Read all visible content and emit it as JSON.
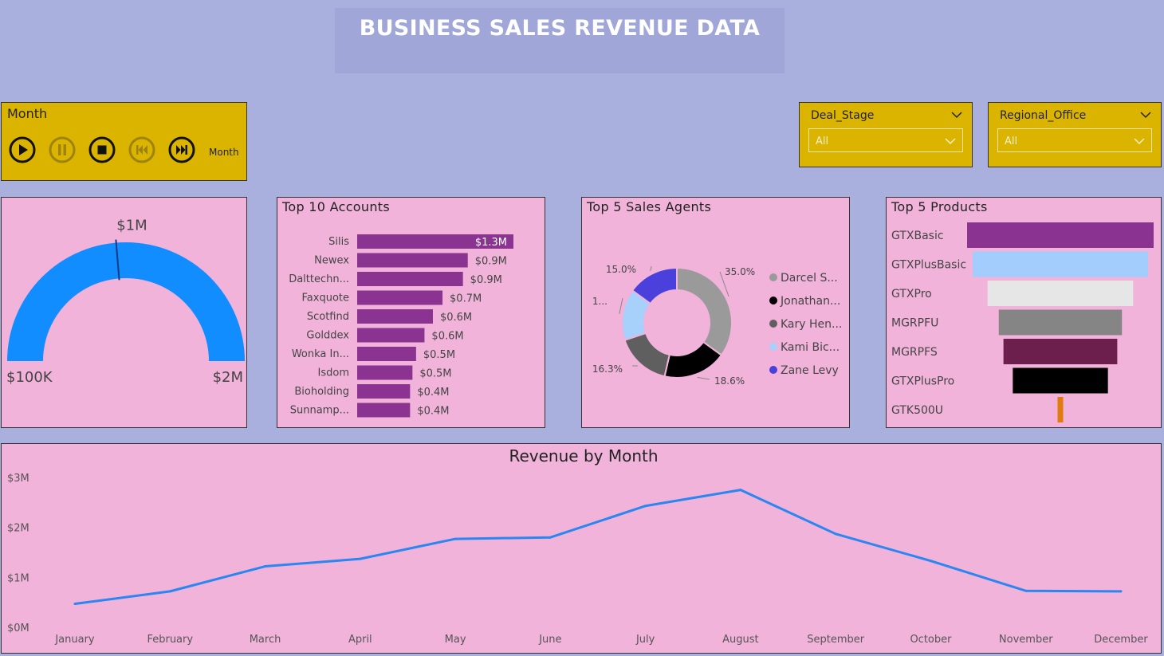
{
  "header": {
    "title": "BUSINESS SALES REVENUE DATA"
  },
  "month_player": {
    "title": "Month",
    "label": "Month",
    "buttons": [
      "play-icon",
      "pause-icon",
      "stop-icon",
      "skip-back-icon",
      "skip-forward-icon"
    ]
  },
  "slicers": {
    "deal_stage": {
      "label": "Deal_Stage",
      "value": "All"
    },
    "regional_office": {
      "label": "Regional_Office",
      "value": "All"
    }
  },
  "colors": {
    "page_bg": "#a9b0de",
    "panel_bg": "#f1b3da",
    "slicer_bg": "#dbb400",
    "gauge_fill": "#118dff",
    "bar": "#8b3391",
    "line": "#2a86f0"
  },
  "chart_data": [
    {
      "type": "gauge",
      "title": "",
      "min": 100000,
      "max": 2000000,
      "value": 2000000,
      "target": 1000000,
      "min_label": "$100K",
      "max_label": "$2M",
      "target_label": "$1M"
    },
    {
      "type": "bar",
      "orientation": "horizontal",
      "title": "Top 10 Accounts",
      "categories": [
        "Silis",
        "Newex",
        "Dalttechn...",
        "Faxquote",
        "Scotfind",
        "Golddex",
        "Wonka In...",
        "Isdom",
        "Bioholding",
        "Sunnamp..."
      ],
      "values": [
        1.3,
        0.92,
        0.88,
        0.71,
        0.63,
        0.56,
        0.49,
        0.46,
        0.44,
        0.44
      ],
      "data_labels": [
        "$1.3M",
        "$0.9M",
        "$0.9M",
        "$0.7M",
        "$0.6M",
        "$0.6M",
        "$0.5M",
        "$0.5M",
        "$0.4M",
        "$0.4M"
      ],
      "unit": "$M"
    },
    {
      "type": "pie",
      "variant": "donut",
      "title": "Top 5 Sales Agents",
      "series": [
        {
          "name": "Darcel S...",
          "value": 35.0,
          "color": "#9a9a9a"
        },
        {
          "name": "Jonathan...",
          "value": 18.6,
          "color": "#000000"
        },
        {
          "name": "Kary Hen...",
          "value": 16.3,
          "color": "#5f5f5f"
        },
        {
          "name": "Kami Bic...",
          "value": 15.1,
          "color": "#a7d1fb"
        },
        {
          "name": "Zane Levy",
          "value": 15.0,
          "color": "#4a41dc"
        }
      ],
      "data_labels": [
        "35.0%",
        "18.6%",
        "16.3%",
        "1...",
        "15.0%"
      ],
      "legend_position": "right"
    },
    {
      "type": "bar",
      "variant": "funnel",
      "title": "Top 5 Products",
      "categories": [
        "GTXBasic",
        "GTXPlusBasic",
        "GTXPro",
        "MGRPFU",
        "MGRPFS",
        "GTXPlusPro",
        "GTK500U"
      ],
      "values": [
        100,
        94,
        78,
        66,
        61,
        51,
        3
      ],
      "colors": [
        "#8b3391",
        "#a2cdfc",
        "#e6e6e6",
        "#858585",
        "#6c1f4d",
        "#000000",
        "#e07b0f"
      ]
    },
    {
      "type": "line",
      "title": "Revenue by Month",
      "x": [
        "January",
        "February",
        "March",
        "April",
        "May",
        "June",
        "July",
        "August",
        "September",
        "October",
        "November",
        "December"
      ],
      "series": [
        {
          "values": [
            0.47,
            0.72,
            1.22,
            1.37,
            1.77,
            1.8,
            2.43,
            2.75,
            1.87,
            1.33,
            0.73,
            0.72
          ]
        }
      ],
      "ylim": [
        0,
        3
      ],
      "yticks": [
        0,
        1,
        2,
        3
      ],
      "ytick_labels": [
        "$0M",
        "$1M",
        "$2M",
        "$3M"
      ]
    }
  ]
}
